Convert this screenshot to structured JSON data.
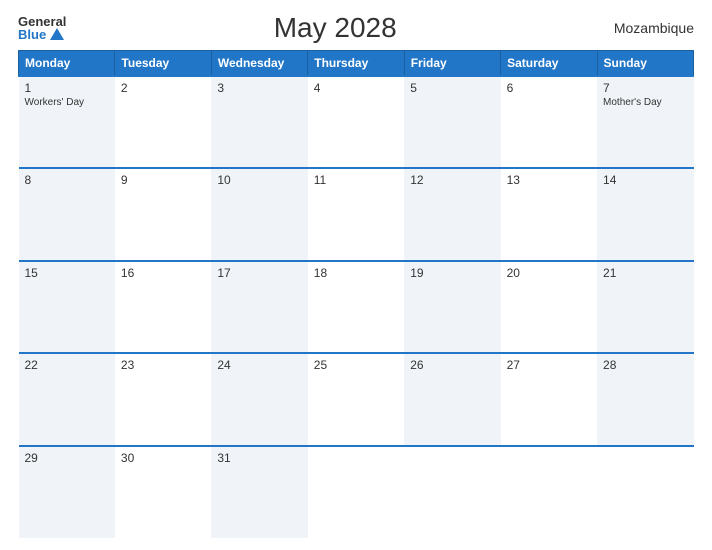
{
  "logo": {
    "general": "General",
    "blue": "Blue"
  },
  "calendar": {
    "title": "May 2028",
    "country": "Mozambique",
    "headers": [
      "Monday",
      "Tuesday",
      "Wednesday",
      "Thursday",
      "Friday",
      "Saturday",
      "Sunday"
    ],
    "weeks": [
      [
        {
          "day": "1",
          "holiday": "Workers' Day"
        },
        {
          "day": "2",
          "holiday": ""
        },
        {
          "day": "3",
          "holiday": ""
        },
        {
          "day": "4",
          "holiday": ""
        },
        {
          "day": "5",
          "holiday": ""
        },
        {
          "day": "6",
          "holiday": ""
        },
        {
          "day": "7",
          "holiday": "Mother's Day"
        }
      ],
      [
        {
          "day": "8",
          "holiday": ""
        },
        {
          "day": "9",
          "holiday": ""
        },
        {
          "day": "10",
          "holiday": ""
        },
        {
          "day": "11",
          "holiday": ""
        },
        {
          "day": "12",
          "holiday": ""
        },
        {
          "day": "13",
          "holiday": ""
        },
        {
          "day": "14",
          "holiday": ""
        }
      ],
      [
        {
          "day": "15",
          "holiday": ""
        },
        {
          "day": "16",
          "holiday": ""
        },
        {
          "day": "17",
          "holiday": ""
        },
        {
          "day": "18",
          "holiday": ""
        },
        {
          "day": "19",
          "holiday": ""
        },
        {
          "day": "20",
          "holiday": ""
        },
        {
          "day": "21",
          "holiday": ""
        }
      ],
      [
        {
          "day": "22",
          "holiday": ""
        },
        {
          "day": "23",
          "holiday": ""
        },
        {
          "day": "24",
          "holiday": ""
        },
        {
          "day": "25",
          "holiday": ""
        },
        {
          "day": "26",
          "holiday": ""
        },
        {
          "day": "27",
          "holiday": ""
        },
        {
          "day": "28",
          "holiday": ""
        }
      ],
      [
        {
          "day": "29",
          "holiday": ""
        },
        {
          "day": "30",
          "holiday": ""
        },
        {
          "day": "31",
          "holiday": ""
        },
        {
          "day": "",
          "holiday": ""
        },
        {
          "day": "",
          "holiday": ""
        },
        {
          "day": "",
          "holiday": ""
        },
        {
          "day": "",
          "holiday": ""
        }
      ]
    ]
  }
}
